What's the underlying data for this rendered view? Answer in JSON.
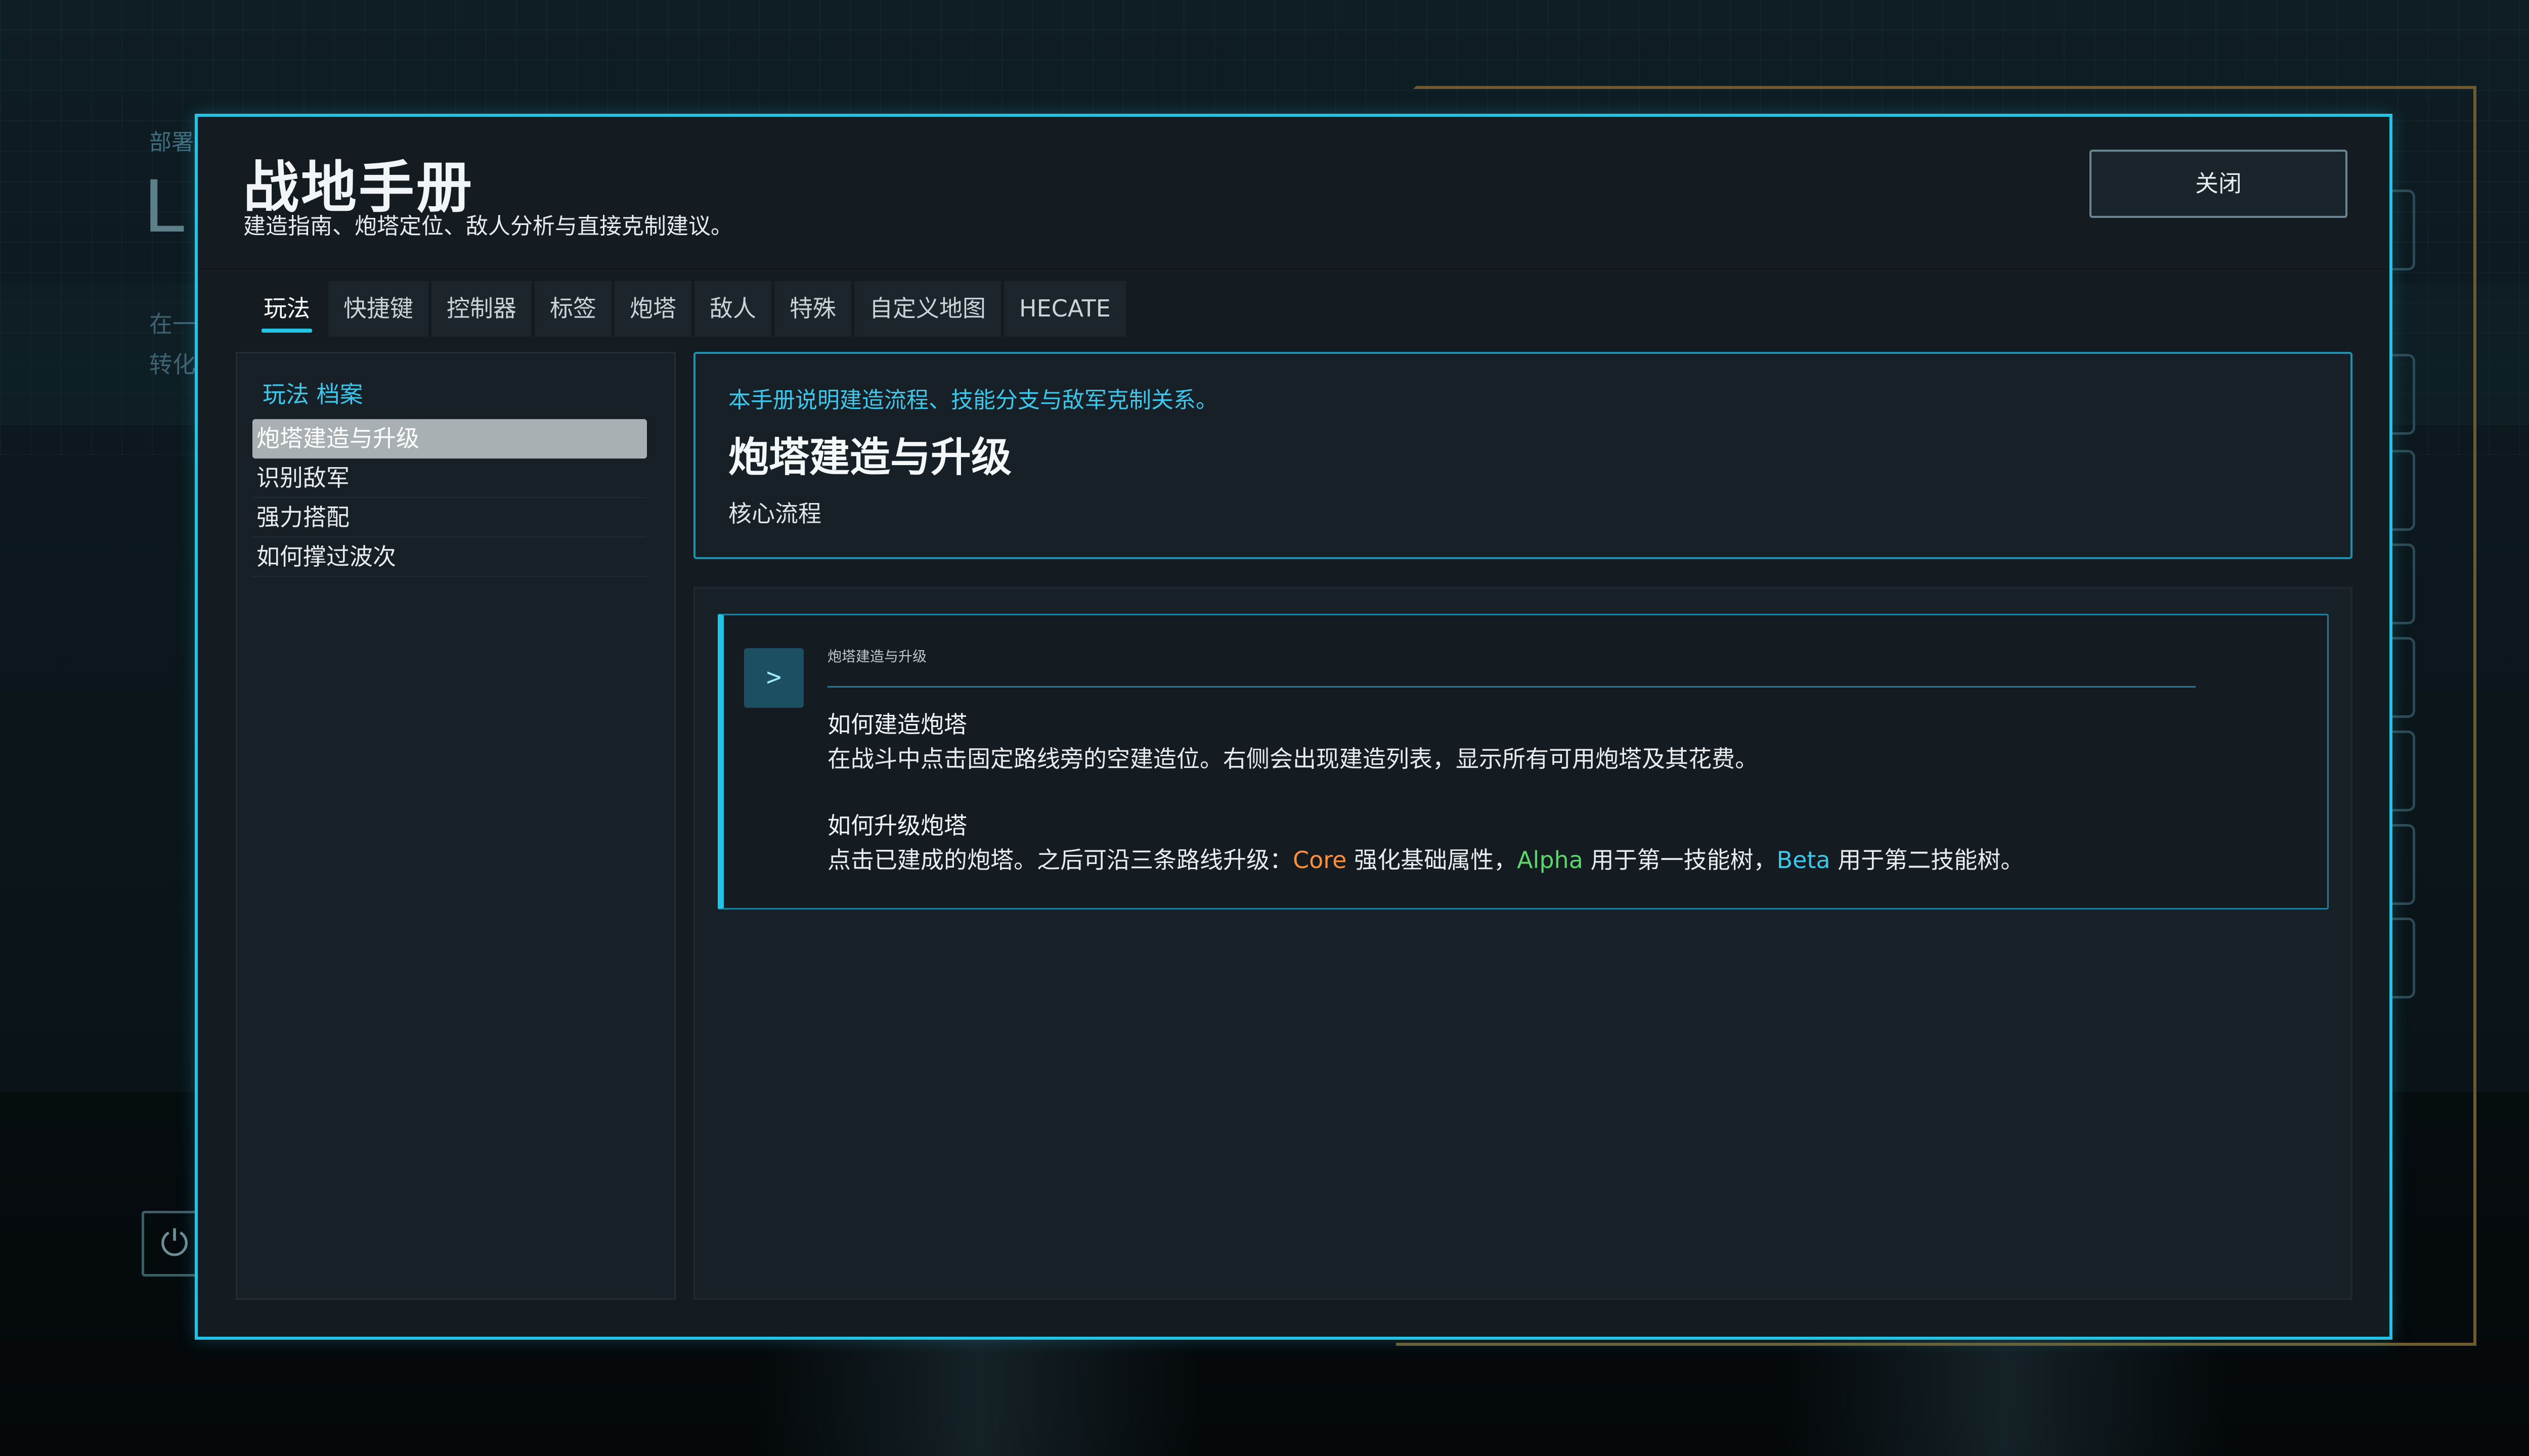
{
  "background": {
    "deploy_text": "部署",
    "big_text": "L",
    "desc_line1": "在一",
    "desc_line2": "转化",
    "power_icon": "power-icon"
  },
  "modal": {
    "title": "战地手册",
    "subtitle": "建造指南、炮塔定位、敌人分析与直接克制建议。",
    "close_label": "关闭"
  },
  "tabs": [
    {
      "label": "玩法",
      "active": true
    },
    {
      "label": "快捷键"
    },
    {
      "label": "控制器"
    },
    {
      "label": "标签"
    },
    {
      "label": "炮塔"
    },
    {
      "label": "敌人"
    },
    {
      "label": "特殊"
    },
    {
      "label": "自定义地图"
    },
    {
      "label": "HECATE"
    }
  ],
  "sidebar": {
    "heading": "玩法 档案",
    "items": [
      {
        "label": "炮塔建造与升级",
        "selected": true
      },
      {
        "label": "识别敌军"
      },
      {
        "label": "强力搭配"
      },
      {
        "label": "如何撑过波次"
      }
    ]
  },
  "info_card": {
    "intro": "本手册说明建造流程、技能分支与敌军克制关系。",
    "title": "炮塔建造与升级",
    "subtitle": "核心流程"
  },
  "entry": {
    "icon_glyph": ">",
    "label": "炮塔建造与升级",
    "section1_heading": "如何建造炮塔",
    "section1_text": "在战斗中点击固定路线旁的空建造位。右侧会出现建造列表，显示所有可用炮塔及其花费。",
    "section2_heading": "如何升级炮塔",
    "section2_prefix": "点击已建成的炮塔。之后可沿三条路线升级：",
    "core_kw": "Core",
    "core_desc": " 强化基础属性，",
    "alpha_kw": "Alpha",
    "alpha_desc": " 用于第一技能树，",
    "beta_kw": "Beta",
    "beta_desc": " 用于第二技能树。"
  },
  "colors": {
    "accent": "#23c3e6",
    "core": "#ff8f3a",
    "alpha": "#5bd66b",
    "beta": "#3ec7ea"
  }
}
